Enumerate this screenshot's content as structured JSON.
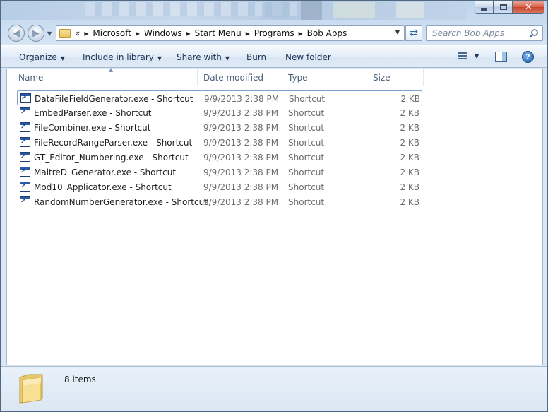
{
  "window": {
    "min_label": "minimize",
    "max_label": "maximize",
    "close_label": "✕"
  },
  "address": {
    "overflow": "«",
    "crumbs": [
      "Microsoft",
      "Windows",
      "Start Menu",
      "Programs",
      "Bob Apps"
    ]
  },
  "search": {
    "placeholder": "Search Bob Apps"
  },
  "toolbar": {
    "organize": "Organize",
    "include": "Include in library",
    "share": "Share with",
    "burn": "Burn",
    "new_folder": "New folder",
    "help": "?"
  },
  "columns": {
    "name": "Name",
    "date": "Date modified",
    "type": "Type",
    "size": "Size"
  },
  "files": [
    {
      "name": "DataFileFieldGenerator.exe - Shortcut",
      "date": "9/9/2013 2:38 PM",
      "type": "Shortcut",
      "size": "2 KB"
    },
    {
      "name": "EmbedParser.exe - Shortcut",
      "date": "9/9/2013 2:38 PM",
      "type": "Shortcut",
      "size": "2 KB"
    },
    {
      "name": "FileCombiner.exe - Shortcut",
      "date": "9/9/2013 2:38 PM",
      "type": "Shortcut",
      "size": "2 KB"
    },
    {
      "name": "FileRecordRangeParser.exe - Shortcut",
      "date": "9/9/2013 2:38 PM",
      "type": "Shortcut",
      "size": "2 KB"
    },
    {
      "name": "GT_Editor_Numbering.exe - Shortcut",
      "date": "9/9/2013 2:38 PM",
      "type": "Shortcut",
      "size": "2 KB"
    },
    {
      "name": "MaitreD_Generator.exe - Shortcut",
      "date": "9/9/2013 2:38 PM",
      "type": "Shortcut",
      "size": "2 KB"
    },
    {
      "name": "Mod10_Applicator.exe - Shortcut",
      "date": "9/9/2013 2:38 PM",
      "type": "Shortcut",
      "size": "2 KB"
    },
    {
      "name": "RandomNumberGenerator.exe - Shortcut",
      "date": "9/9/2013 2:38 PM",
      "type": "Shortcut",
      "size": "2 KB"
    }
  ],
  "details": {
    "count": "8 items"
  },
  "icons": {
    "back": "back-arrow-icon",
    "forward": "forward-arrow-icon",
    "refresh": "refresh-icon",
    "search": "search-icon",
    "views": "views-icon",
    "preview_pane": "preview-pane-icon",
    "help": "help-icon",
    "shortcut": "shortcut-icon",
    "folder": "folder-icon"
  },
  "colors": {
    "accent": "#2a5ba8",
    "frame": "#c5d7ea",
    "close": "#c7432c"
  }
}
